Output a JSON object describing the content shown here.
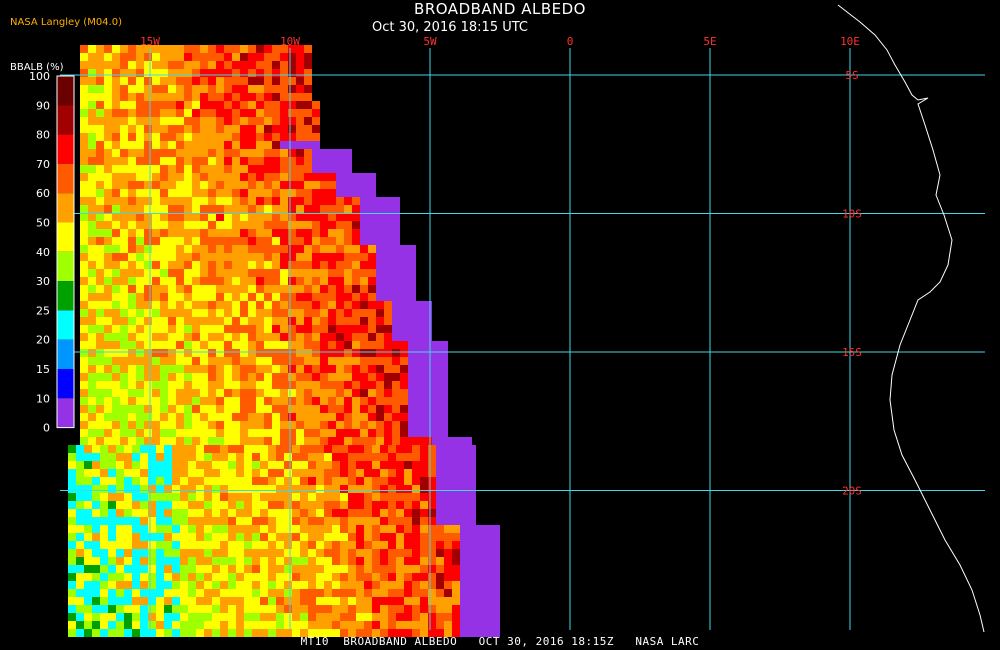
{
  "header": {
    "title": "BROADBAND ALBEDO",
    "subtitle": "Oct 30, 2016 18:15 UTC",
    "producer": "NASA Langley (M04.0)"
  },
  "legend": {
    "title": "BBALB (%)",
    "stops": [
      {
        "label": "100",
        "color": "#6b0000"
      },
      {
        "label": "90",
        "color": "#a00000"
      },
      {
        "label": "80",
        "color": "#ff0000"
      },
      {
        "label": "70",
        "color": "#ff5a00"
      },
      {
        "label": "60",
        "color": "#ffa000"
      },
      {
        "label": "50",
        "color": "#ffff00"
      },
      {
        "label": "40",
        "color": "#a0ff00"
      },
      {
        "label": "30",
        "color": "#00a000"
      },
      {
        "label": "25",
        "color": "#00ffff"
      },
      {
        "label": "20",
        "color": "#0096ff"
      },
      {
        "label": "15",
        "color": "#0000ff"
      },
      {
        "label": "10",
        "color": "#9632e6"
      },
      {
        "label": "0",
        "color": ""
      }
    ]
  },
  "grid": {
    "longitudes": [
      {
        "label": "15W",
        "lon": -15
      },
      {
        "label": "10W",
        "lon": -10
      },
      {
        "label": "5W",
        "lon": -5
      },
      {
        "label": "0",
        "lon": 0
      },
      {
        "label": "5E",
        "lon": 5
      },
      {
        "label": "10E",
        "lon": 10
      }
    ],
    "latitudes": [
      {
        "label": "5S",
        "lat": -5
      },
      {
        "label": "10S",
        "lat": -10
      },
      {
        "label": "15S",
        "lat": -15
      },
      {
        "label": "20S",
        "lat": -20
      }
    ],
    "line_color": "#40d8e8",
    "label_color": "#ff3030"
  },
  "footer": "MT10  BROADBAND ALBEDO   OCT 30, 2016 18:15Z   NASA LARC",
  "colors": {
    "background": "#000000",
    "no_data": "#9632e6",
    "coastline": "#ffffff"
  }
}
